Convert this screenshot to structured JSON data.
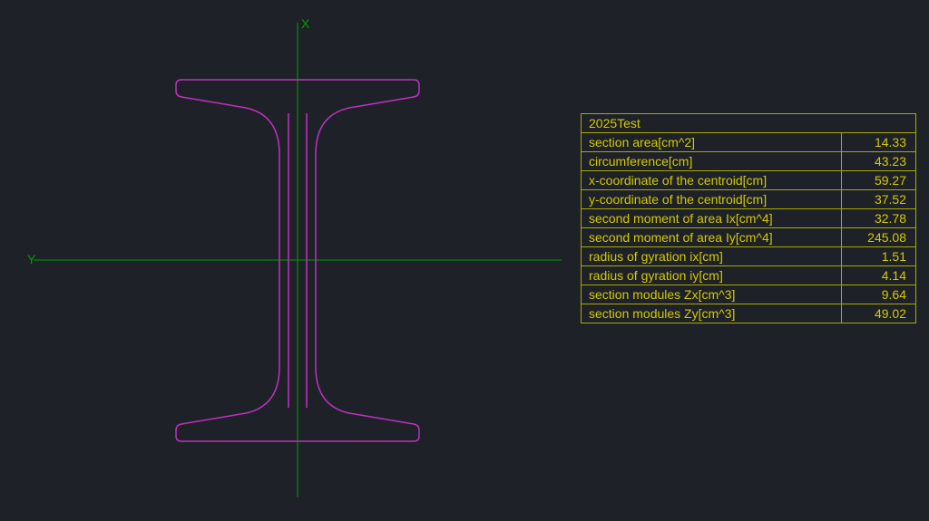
{
  "axes": {
    "x_label": "X",
    "y_label": "Y"
  },
  "table": {
    "title": "2025Test",
    "rows": [
      {
        "label": "section area[cm^2]",
        "value": "14.33"
      },
      {
        "label": "circumference[cm]",
        "value": "43.23"
      },
      {
        "label": "x-coordinate of the centroid[cm]",
        "value": "59.27"
      },
      {
        "label": "y-coordinate of the centroid[cm]",
        "value": "37.52"
      },
      {
        "label": "second moment of area Ix[cm^4]",
        "value": "32.78"
      },
      {
        "label": "second moment of area Iy[cm^4]",
        "value": "245.08"
      },
      {
        "label": "radius of gyration ix[cm]",
        "value": "1.51"
      },
      {
        "label": "radius of gyration iy[cm]",
        "value": "4.14"
      },
      {
        "label": "section modules Zx[cm^3]",
        "value": "9.64"
      },
      {
        "label": "section modules Zy[cm^3]",
        "value": "49.02"
      }
    ]
  }
}
